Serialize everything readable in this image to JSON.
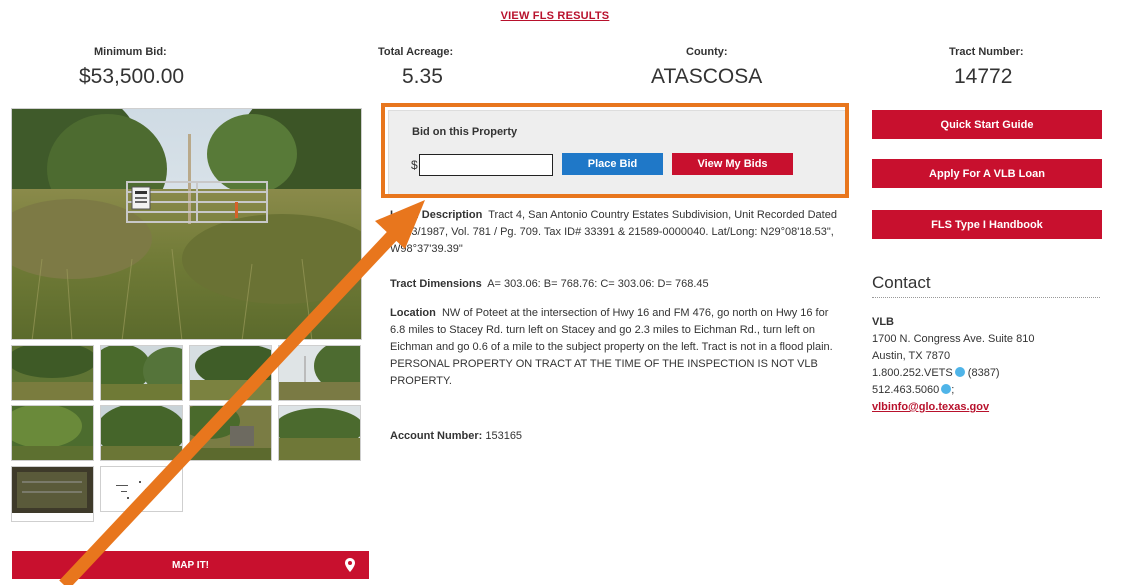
{
  "header": {
    "fls_link": "VIEW FLS RESULTS"
  },
  "stats": {
    "minimum_bid": {
      "label": "Minimum Bid:",
      "value": "$53,500.00"
    },
    "total_acreage": {
      "label": "Total Acreage:",
      "value": "5.35"
    },
    "county": {
      "label": "County:",
      "value": "ATASCOSA"
    },
    "tract_number": {
      "label": "Tract Number:",
      "value": "14772"
    }
  },
  "bid": {
    "title": "Bid on this Property",
    "currency": "$",
    "input_value": "",
    "place_bid": "Place Bid",
    "view_my_bids": "View My Bids"
  },
  "details": {
    "legal_label": "Legal Description",
    "legal_text": "Tract 4, San Antonio Country Estates Subdivision, Unit Recorded Dated 05/13/1987, Vol. 781 / Pg. 709. Tax ID# 33391 & 21589-0000040. Lat/Long: N29°08'18.53\", W98°37'39.39\"",
    "dims_label": "Tract Dimensions",
    "dims_text": "A= 303.06: B= 768.76: C= 303.06: D= 768.45",
    "location_label": "Location",
    "location_text": "NW of Poteet at the intersection of Hwy 16 and FM 476, go north on Hwy 16 for 6.8 miles to Stacey Rd. turn left on Stacey and go 2.3 miles to Eichman Rd., turn left on Eichman and go 0.6 of a mile to the subject property on the left. Tract is not in a flood plain. PERSONAL PROPERTY ON TRACT AT THE TIME OF THE INSPECTION IS NOT VLB PROPERTY.",
    "account_label": "Account Number:",
    "account_value": "153165"
  },
  "sidebar": {
    "quick_start": "Quick Start Guide",
    "apply_loan": "Apply For A VLB Loan",
    "handbook": "FLS Type I Handbook"
  },
  "contact": {
    "heading": "Contact",
    "org": "VLB",
    "address1": "1700 N. Congress Ave. Suite 810",
    "address2": "Austin, TX 7870",
    "phone1": "1.800.252.VETS",
    "phone1_ext": "(8387)",
    "phone2": "512.463.5060",
    "phone2_suffix": ";",
    "email": "vlbinfo@glo.texas.gov"
  },
  "map": {
    "label": "MAP IT!"
  },
  "colors": {
    "brand_red": "#c8102e",
    "link_red": "#b8112c",
    "button_blue": "#1f78c8",
    "highlight_orange": "#e8761d",
    "panel_gray": "#eeeeee"
  },
  "icons": {
    "map_marker": "map-marker-icon",
    "phone": "phone-icon"
  }
}
